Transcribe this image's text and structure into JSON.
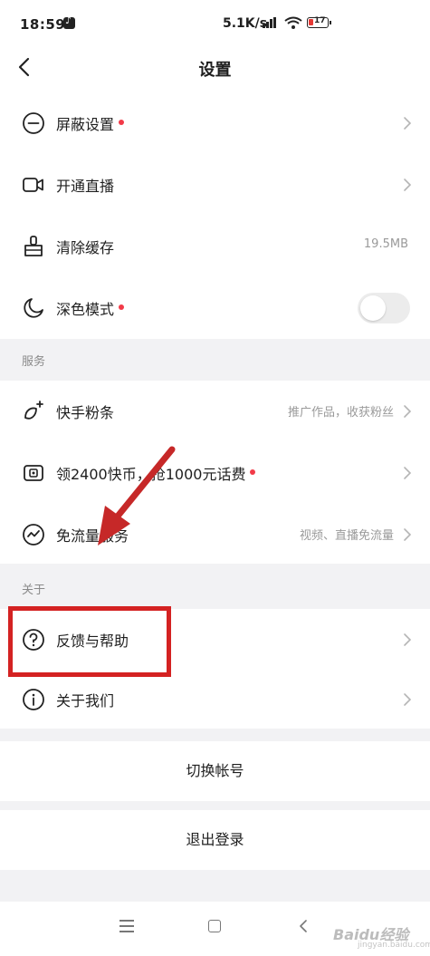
{
  "status_bar": {
    "time": "18:59",
    "network_speed": "5.1K/s",
    "signal_badge": "HD",
    "battery_level": "17",
    "battery_color": "#e53935"
  },
  "header": {
    "title": "设置",
    "back_icon": "chevron-left-icon"
  },
  "general_items": [
    {
      "label": "屏蔽设置",
      "icon": "minus-circle-icon",
      "has_dot": true,
      "trailing": "chevron"
    },
    {
      "label": "开通直播",
      "icon": "video-camera-icon",
      "has_dot": false,
      "trailing": "chevron"
    },
    {
      "label": "清除缓存",
      "icon": "broom-icon",
      "has_dot": false,
      "value": "19.5MB"
    },
    {
      "label": "深色模式",
      "icon": "moon-icon",
      "has_dot": true,
      "trailing": "toggle",
      "toggle_on": false
    }
  ],
  "services_section": {
    "title": "服务",
    "items": [
      {
        "label": "快手粉条",
        "icon": "sparkle-leaf-icon",
        "hint": "推广作品，收获粉丝",
        "has_dot": false
      },
      {
        "label": "领2400快币，抢1000元话费",
        "icon": "wallet-icon",
        "hint": "",
        "has_dot": true
      },
      {
        "label": "免流量服务",
        "icon": "wave-circle-icon",
        "hint": "视频、直播免流量",
        "has_dot": false
      }
    ]
  },
  "about_section": {
    "title": "关于",
    "items": [
      {
        "label": "反馈与帮助",
        "icon": "question-circle-icon"
      },
      {
        "label": "关于我们",
        "icon": "info-circle-icon"
      }
    ]
  },
  "actions": {
    "switch_account": "切换帐号",
    "logout": "退出登录"
  },
  "nav_bar": {
    "menu_icon": "menu-icon",
    "home_icon": "square-home-icon",
    "back_icon": "back-triangle-icon"
  },
  "annotation": {
    "highlight_color": "#d42222",
    "highlighted_item": "反馈与帮助"
  },
  "watermark": {
    "brand": "Baidu经验",
    "url": "jingyan.baidu.com"
  }
}
